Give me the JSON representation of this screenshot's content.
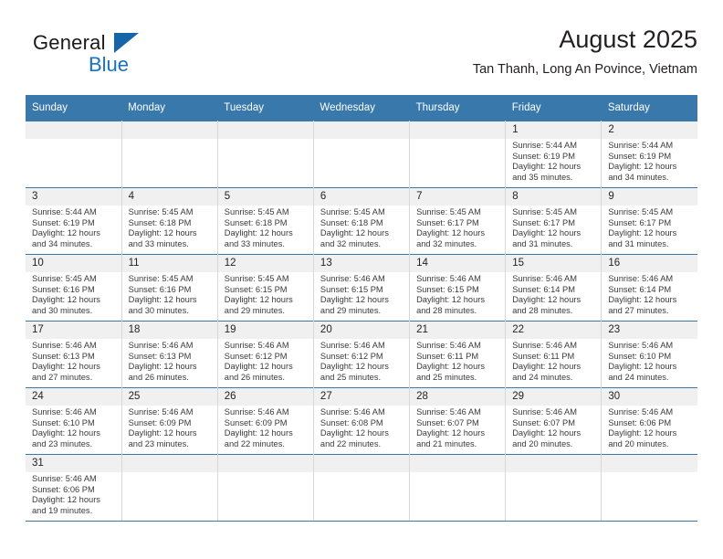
{
  "brand": {
    "name_top": "General",
    "name_bottom": "Blue",
    "triangle_color": "#1565a8",
    "blue_color": "#1573bf"
  },
  "header": {
    "title": "August 2025",
    "subtitle": "Tan Thanh, Long An Povince, Vietnam"
  },
  "theme": {
    "header_bg": "#3878ab",
    "daynum_bg": "#f0f0f0",
    "grid_line": "#3878ab"
  },
  "calendar": {
    "weekday_headers": [
      "Sunday",
      "Monday",
      "Tuesday",
      "Wednesday",
      "Thursday",
      "Friday",
      "Saturday"
    ],
    "weeks": [
      [
        {
          "day": "",
          "lines": []
        },
        {
          "day": "",
          "lines": []
        },
        {
          "day": "",
          "lines": []
        },
        {
          "day": "",
          "lines": []
        },
        {
          "day": "",
          "lines": []
        },
        {
          "day": "1",
          "lines": [
            "Sunrise: 5:44 AM",
            "Sunset: 6:19 PM",
            "Daylight: 12 hours",
            "and 35 minutes."
          ]
        },
        {
          "day": "2",
          "lines": [
            "Sunrise: 5:44 AM",
            "Sunset: 6:19 PM",
            "Daylight: 12 hours",
            "and 34 minutes."
          ]
        }
      ],
      [
        {
          "day": "3",
          "lines": [
            "Sunrise: 5:44 AM",
            "Sunset: 6:19 PM",
            "Daylight: 12 hours",
            "and 34 minutes."
          ]
        },
        {
          "day": "4",
          "lines": [
            "Sunrise: 5:45 AM",
            "Sunset: 6:18 PM",
            "Daylight: 12 hours",
            "and 33 minutes."
          ]
        },
        {
          "day": "5",
          "lines": [
            "Sunrise: 5:45 AM",
            "Sunset: 6:18 PM",
            "Daylight: 12 hours",
            "and 33 minutes."
          ]
        },
        {
          "day": "6",
          "lines": [
            "Sunrise: 5:45 AM",
            "Sunset: 6:18 PM",
            "Daylight: 12 hours",
            "and 32 minutes."
          ]
        },
        {
          "day": "7",
          "lines": [
            "Sunrise: 5:45 AM",
            "Sunset: 6:17 PM",
            "Daylight: 12 hours",
            "and 32 minutes."
          ]
        },
        {
          "day": "8",
          "lines": [
            "Sunrise: 5:45 AM",
            "Sunset: 6:17 PM",
            "Daylight: 12 hours",
            "and 31 minutes."
          ]
        },
        {
          "day": "9",
          "lines": [
            "Sunrise: 5:45 AM",
            "Sunset: 6:17 PM",
            "Daylight: 12 hours",
            "and 31 minutes."
          ]
        }
      ],
      [
        {
          "day": "10",
          "lines": [
            "Sunrise: 5:45 AM",
            "Sunset: 6:16 PM",
            "Daylight: 12 hours",
            "and 30 minutes."
          ]
        },
        {
          "day": "11",
          "lines": [
            "Sunrise: 5:45 AM",
            "Sunset: 6:16 PM",
            "Daylight: 12 hours",
            "and 30 minutes."
          ]
        },
        {
          "day": "12",
          "lines": [
            "Sunrise: 5:45 AM",
            "Sunset: 6:15 PM",
            "Daylight: 12 hours",
            "and 29 minutes."
          ]
        },
        {
          "day": "13",
          "lines": [
            "Sunrise: 5:46 AM",
            "Sunset: 6:15 PM",
            "Daylight: 12 hours",
            "and 29 minutes."
          ]
        },
        {
          "day": "14",
          "lines": [
            "Sunrise: 5:46 AM",
            "Sunset: 6:15 PM",
            "Daylight: 12 hours",
            "and 28 minutes."
          ]
        },
        {
          "day": "15",
          "lines": [
            "Sunrise: 5:46 AM",
            "Sunset: 6:14 PM",
            "Daylight: 12 hours",
            "and 28 minutes."
          ]
        },
        {
          "day": "16",
          "lines": [
            "Sunrise: 5:46 AM",
            "Sunset: 6:14 PM",
            "Daylight: 12 hours",
            "and 27 minutes."
          ]
        }
      ],
      [
        {
          "day": "17",
          "lines": [
            "Sunrise: 5:46 AM",
            "Sunset: 6:13 PM",
            "Daylight: 12 hours",
            "and 27 minutes."
          ]
        },
        {
          "day": "18",
          "lines": [
            "Sunrise: 5:46 AM",
            "Sunset: 6:13 PM",
            "Daylight: 12 hours",
            "and 26 minutes."
          ]
        },
        {
          "day": "19",
          "lines": [
            "Sunrise: 5:46 AM",
            "Sunset: 6:12 PM",
            "Daylight: 12 hours",
            "and 26 minutes."
          ]
        },
        {
          "day": "20",
          "lines": [
            "Sunrise: 5:46 AM",
            "Sunset: 6:12 PM",
            "Daylight: 12 hours",
            "and 25 minutes."
          ]
        },
        {
          "day": "21",
          "lines": [
            "Sunrise: 5:46 AM",
            "Sunset: 6:11 PM",
            "Daylight: 12 hours",
            "and 25 minutes."
          ]
        },
        {
          "day": "22",
          "lines": [
            "Sunrise: 5:46 AM",
            "Sunset: 6:11 PM",
            "Daylight: 12 hours",
            "and 24 minutes."
          ]
        },
        {
          "day": "23",
          "lines": [
            "Sunrise: 5:46 AM",
            "Sunset: 6:10 PM",
            "Daylight: 12 hours",
            "and 24 minutes."
          ]
        }
      ],
      [
        {
          "day": "24",
          "lines": [
            "Sunrise: 5:46 AM",
            "Sunset: 6:10 PM",
            "Daylight: 12 hours",
            "and 23 minutes."
          ]
        },
        {
          "day": "25",
          "lines": [
            "Sunrise: 5:46 AM",
            "Sunset: 6:09 PM",
            "Daylight: 12 hours",
            "and 23 minutes."
          ]
        },
        {
          "day": "26",
          "lines": [
            "Sunrise: 5:46 AM",
            "Sunset: 6:09 PM",
            "Daylight: 12 hours",
            "and 22 minutes."
          ]
        },
        {
          "day": "27",
          "lines": [
            "Sunrise: 5:46 AM",
            "Sunset: 6:08 PM",
            "Daylight: 12 hours",
            "and 22 minutes."
          ]
        },
        {
          "day": "28",
          "lines": [
            "Sunrise: 5:46 AM",
            "Sunset: 6:07 PM",
            "Daylight: 12 hours",
            "and 21 minutes."
          ]
        },
        {
          "day": "29",
          "lines": [
            "Sunrise: 5:46 AM",
            "Sunset: 6:07 PM",
            "Daylight: 12 hours",
            "and 20 minutes."
          ]
        },
        {
          "day": "30",
          "lines": [
            "Sunrise: 5:46 AM",
            "Sunset: 6:06 PM",
            "Daylight: 12 hours",
            "and 20 minutes."
          ]
        }
      ],
      [
        {
          "day": "31",
          "lines": [
            "Sunrise: 5:46 AM",
            "Sunset: 6:06 PM",
            "Daylight: 12 hours",
            "and 19 minutes."
          ]
        },
        {
          "day": "",
          "lines": []
        },
        {
          "day": "",
          "lines": []
        },
        {
          "day": "",
          "lines": []
        },
        {
          "day": "",
          "lines": []
        },
        {
          "day": "",
          "lines": []
        },
        {
          "day": "",
          "lines": []
        }
      ]
    ]
  }
}
